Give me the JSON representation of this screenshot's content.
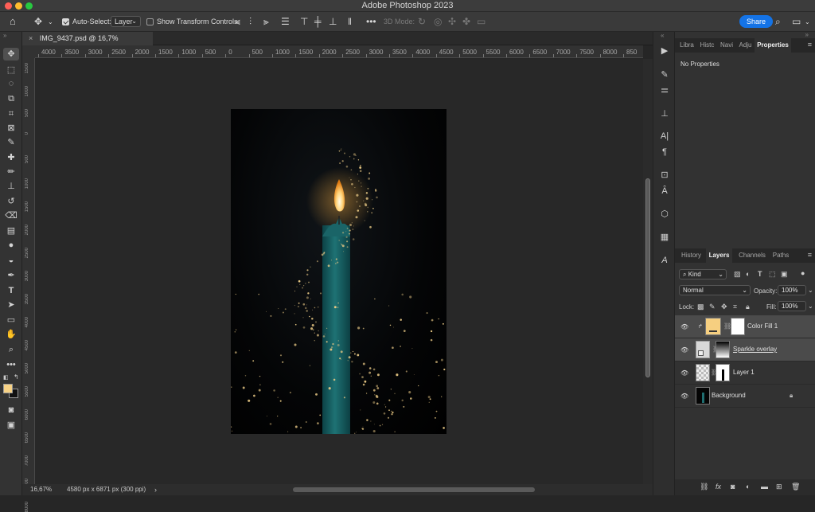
{
  "window": {
    "title": "Adobe Photoshop 2023"
  },
  "options_bar": {
    "auto_select_label": "Auto-Select:",
    "auto_select_checked": true,
    "auto_select_target": "Layer",
    "show_transform_label": "Show Transform Controls",
    "show_transform_checked": false,
    "mode_3d_label": "3D Mode:",
    "share_label": "Share"
  },
  "document": {
    "tab_title": "IMG_9437.psd @ 16,7% (RGB/16*) *",
    "zoom": "16,67%",
    "info": "4580 px x 6871 px (300 ppi)"
  },
  "ruler": {
    "horizontal_ticks": [
      "4000",
      "3500",
      "3000",
      "2500",
      "2000",
      "1500",
      "1000",
      "500",
      "0",
      "500",
      "1000",
      "1500",
      "2000",
      "2500",
      "3000",
      "3500",
      "4000",
      "4500",
      "5000",
      "5500",
      "6000",
      "6500",
      "7000",
      "7500",
      "8000",
      "850"
    ],
    "vertical_ticks": [
      "1500",
      "1000",
      "500",
      "0",
      "500",
      "1000",
      "1500",
      "2000",
      "2500",
      "3000",
      "3500",
      "4000",
      "4500",
      "5000",
      "5500",
      "6000",
      "6500",
      "7000",
      "7500",
      "8000"
    ]
  },
  "properties_panel": {
    "tabs": [
      "Libra",
      "Histc",
      "Navi",
      "Adju",
      "Properties"
    ],
    "active_tab": "Properties",
    "empty_text": "No Properties"
  },
  "layers_panel": {
    "tabs": [
      "History",
      "Layers",
      "Channels",
      "Paths"
    ],
    "active_tab": "Layers",
    "filter_kind": "Kind",
    "blend_mode": "Normal",
    "opacity_label": "Opacity:",
    "opacity_value": "100%",
    "lock_label": "Lock:",
    "fill_label": "Fill:",
    "fill_value": "100%",
    "layers": [
      {
        "name": "Color Fill 1",
        "visible": true,
        "selected": true,
        "swatch": "#f6cf80"
      },
      {
        "name": "Sparkle overlay",
        "visible": true,
        "selected": true
      },
      {
        "name": "Layer 1",
        "visible": true,
        "selected": false
      },
      {
        "name": "Background",
        "visible": true,
        "selected": false,
        "locked": true
      }
    ]
  },
  "colors": {
    "foreground": "#f7d286",
    "background": "#111111",
    "accent": "#1473e6"
  }
}
